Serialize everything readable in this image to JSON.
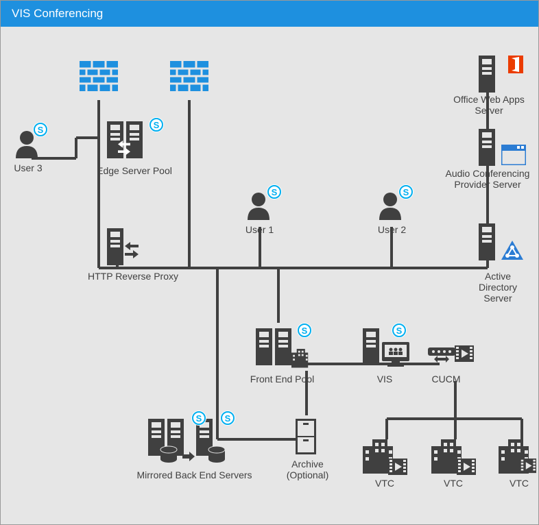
{
  "title": "VIS Conferencing",
  "nodes": {
    "user3": "User 3",
    "edge_pool": "Edge Server Pool",
    "user1": "User 1",
    "user2": "User 2",
    "owa": "Office Web Apps\nServer",
    "acp": "Audio Conferencing\nProvider Server",
    "ads": "Active\nDirectory\nServer",
    "http_proxy": "HTTP Reverse Proxy",
    "front_end": "Front End Pool",
    "vis": "VIS",
    "cucm": "CUCM",
    "mirrored": "Mirrored Back End Servers",
    "archive": "Archive\n(Optional)",
    "vtc1": "VTC",
    "vtc2": "VTC",
    "vtc3": "VTC"
  },
  "colors": {
    "header": "#1e90df",
    "icon": "#404040",
    "skype": "#00aff0",
    "firewall": "#1e90df",
    "office_red": "#eb3c00",
    "ad_blue": "#2b7cd3"
  }
}
